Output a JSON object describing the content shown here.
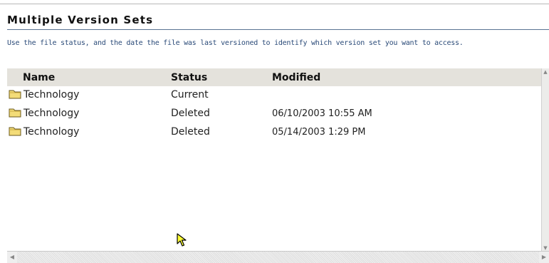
{
  "page": {
    "title": "Multiple Version Sets",
    "instructions": "Use the file status, and the date the file was last versioned to identify which version set you want to access."
  },
  "list": {
    "columns": {
      "name": "Name",
      "status": "Status",
      "modified": "Modified"
    },
    "rows": [
      {
        "name": "Technology",
        "status": "Current",
        "modified": ""
      },
      {
        "name": "Technology",
        "status": "Deleted",
        "modified": "06/10/2003 10:55 AM"
      },
      {
        "name": "Technology",
        "status": "Deleted",
        "modified": "05/14/2003 1:29 PM"
      }
    ],
    "row_icon": "folder-icon"
  },
  "colors": {
    "header_background": "#e4e2dc",
    "instructions_text": "#2a4a78",
    "folder_fill": "#f3dc78",
    "cursor_fill": "#ffff33"
  },
  "icons": {
    "folder": "folder-icon",
    "cursor": "mouse-pointer-icon",
    "scroll_left": "scroll-left-arrow-icon",
    "scroll_right": "scroll-right-arrow-icon",
    "scroll_up": "scroll-up-arrow-icon",
    "scroll_down": "scroll-down-arrow-icon"
  }
}
